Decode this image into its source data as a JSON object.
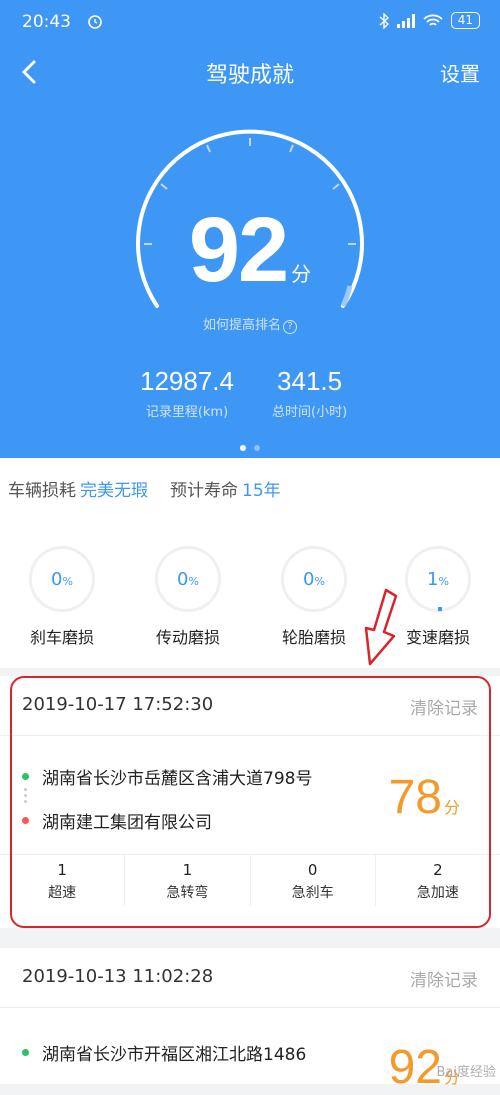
{
  "status": {
    "time": "20:43",
    "battery": "41"
  },
  "nav": {
    "title": "驾驶成就",
    "settings": "设置"
  },
  "score": {
    "value": "92",
    "unit": "分",
    "improve": "如何提高排名",
    "q": "?"
  },
  "stats": [
    {
      "value": "12987.4",
      "label": "记录里程(km)"
    },
    {
      "value": "341.5",
      "label": "总时间(小时)"
    }
  ],
  "wear": {
    "label": "车辆损耗",
    "status": "完美无瑕",
    "life_label": "预计寿命",
    "life": "15年",
    "items": [
      {
        "value": "0",
        "unit": "%",
        "label": "刹车磨损"
      },
      {
        "value": "0",
        "unit": "%",
        "label": "传动磨损"
      },
      {
        "value": "0",
        "unit": "%",
        "label": "轮胎磨损"
      },
      {
        "value": "1",
        "unit": "%",
        "label": "变速磨损"
      }
    ]
  },
  "trips": [
    {
      "time": "2019-10-17 17:52:30",
      "clear": "清除记录",
      "from": "湖南省长沙市岳麓区含浦大道798号",
      "to": "湖南建工集团有限公司",
      "score": "78",
      "unit": "分",
      "stats": [
        {
          "n": "1",
          "t": "超速"
        },
        {
          "n": "1",
          "t": "急转弯"
        },
        {
          "n": "0",
          "t": "急刹车"
        },
        {
          "n": "2",
          "t": "急加速"
        }
      ]
    },
    {
      "time": "2019-10-13 11:02:28",
      "clear": "清除记录",
      "from": "湖南省长沙市开福区湘江北路1486",
      "score": "92",
      "unit": "分"
    }
  ],
  "watermark": "Bai度经验",
  "colors": {
    "primary": "#3f97f5",
    "score": "#f39a2b",
    "annotation": "#d6262c"
  }
}
